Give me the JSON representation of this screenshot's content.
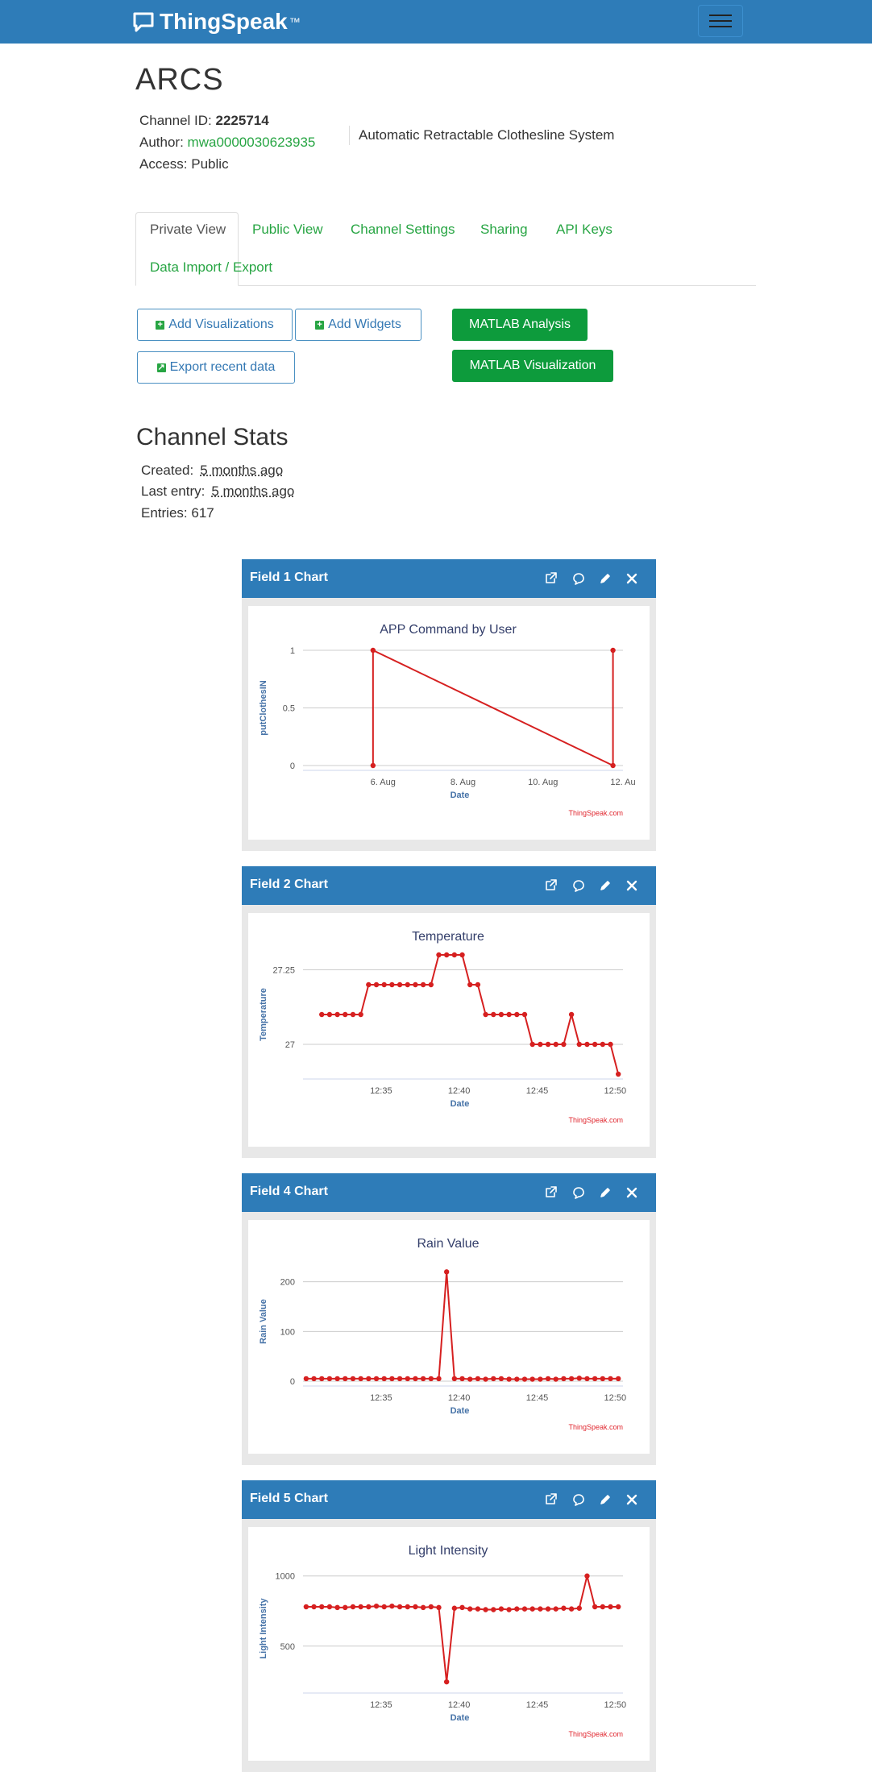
{
  "navbar": {
    "brand": "ThingSpeak",
    "brand_tm": "™"
  },
  "channel": {
    "name": "ARCS",
    "id_label": "Channel ID:",
    "id_value": "2225714",
    "author_label": "Author:",
    "author_value": "mwa0000030623935",
    "access_label": "Access:",
    "access_value": "Public",
    "description": "Automatic Retractable Clothesline System"
  },
  "tabs": [
    "Private View",
    "Public View",
    "Channel Settings",
    "Sharing",
    "API Keys",
    "Data Import / Export"
  ],
  "buttons": {
    "add_visualizations": "Add Visualizations",
    "add_widgets": "Add Widgets",
    "export_recent": "Export recent data",
    "matlab_analysis": "MATLAB Analysis",
    "matlab_visualization": "MATLAB Visualization"
  },
  "stats": {
    "heading": "Channel Stats",
    "created_label": "Created:",
    "created_value": "5 months ago",
    "last_entry_label": "Last entry:",
    "last_entry_value": "5 months ago",
    "entries_label": "Entries:",
    "entries_value": "617"
  },
  "colors": {
    "navbar": "#2e7cb8",
    "link": "#27a543",
    "matlab_button": "#0d9b3c",
    "series": "#d62020"
  },
  "icons": [
    "external-link-icon",
    "comment-icon",
    "pencil-icon",
    "close-icon"
  ],
  "credit": "ThingSpeak.com",
  "chart_data": [
    {
      "panel_title": "Field 1 Chart",
      "type": "line",
      "title": "APP Command by User",
      "xlabel": "Date",
      "ylabel": "putClothesIN",
      "x_ticks": [
        "6. Aug",
        "8. Aug",
        "10. Aug",
        "12. Au"
      ],
      "y_ticks": [
        "0",
        "0.5",
        "1"
      ],
      "ylim": [
        0,
        1
      ],
      "x_unit": "days since 4 Aug",
      "xlim": [
        0,
        8
      ],
      "x_tick_values": [
        2,
        4,
        6,
        8
      ],
      "y_tick_values": [
        0,
        0.5,
        1
      ],
      "series": [
        {
          "x": [
            1.75,
            1.75,
            7.75,
            7.75
          ],
          "values": [
            0,
            1,
            0,
            1
          ]
        }
      ]
    },
    {
      "panel_title": "Field 2 Chart",
      "type": "line",
      "title": "Temperature",
      "xlabel": "Date",
      "ylabel": "Temperature",
      "x_ticks": [
        "12:35",
        "12:40",
        "12:45",
        "12:50"
      ],
      "y_ticks": [
        "27",
        "27.25"
      ],
      "ylim": [
        26.9,
        27.3
      ],
      "xlim": [
        30,
        50.5
      ],
      "x_tick_values": [
        35,
        40,
        45,
        50
      ],
      "y_tick_values": [
        27,
        27.25
      ],
      "series": [
        {
          "x": [
            31.2,
            31.7,
            32.2,
            32.7,
            33.2,
            33.7,
            34.2,
            34.7,
            35.2,
            35.7,
            36.2,
            36.7,
            37.2,
            37.7,
            38.2,
            38.7,
            39.2,
            39.7,
            40.2,
            40.7,
            41.2,
            41.7,
            42.2,
            42.7,
            43.2,
            43.7,
            44.2,
            44.7,
            45.2,
            45.7,
            46.2,
            46.7,
            47.2,
            47.7,
            48.2,
            48.7,
            49.2,
            49.7,
            50.2
          ],
          "values": [
            27.1,
            27.1,
            27.1,
            27.1,
            27.1,
            27.1,
            27.2,
            27.2,
            27.2,
            27.2,
            27.2,
            27.2,
            27.2,
            27.2,
            27.2,
            27.3,
            27.3,
            27.3,
            27.3,
            27.2,
            27.2,
            27.1,
            27.1,
            27.1,
            27.1,
            27.1,
            27.1,
            27.0,
            27.0,
            27.0,
            27.0,
            27.0,
            27.1,
            27.0,
            27.0,
            27.0,
            27.0,
            27.0,
            26.9
          ]
        }
      ]
    },
    {
      "panel_title": "Field 4 Chart",
      "type": "line",
      "title": "Rain Value",
      "xlabel": "Date",
      "ylabel": "Rain Value",
      "x_ticks": [
        "12:35",
        "12:40",
        "12:45",
        "12:50"
      ],
      "y_ticks": [
        "0",
        "100",
        "200"
      ],
      "ylim": [
        0,
        240
      ],
      "xlim": [
        30,
        50.5
      ],
      "x_tick_values": [
        35,
        40,
        45,
        50
      ],
      "y_tick_values": [
        0,
        100,
        200
      ],
      "series": [
        {
          "x": [
            30.2,
            30.7,
            31.2,
            31.7,
            32.2,
            32.7,
            33.2,
            33.7,
            34.2,
            34.7,
            35.2,
            35.7,
            36.2,
            36.7,
            37.2,
            37.7,
            38.2,
            38.7,
            39.2,
            39.7,
            40.2,
            40.7,
            41.2,
            41.7,
            42.2,
            42.7,
            43.2,
            43.7,
            44.2,
            44.7,
            45.2,
            45.7,
            46.2,
            46.7,
            47.2,
            47.7,
            48.2,
            48.7,
            49.2,
            49.7,
            50.2
          ],
          "values": [
            5,
            5,
            5,
            5,
            5,
            5,
            5,
            5,
            5,
            5,
            5,
            5,
            5,
            5,
            5,
            5,
            5,
            5,
            220,
            5,
            5,
            4,
            5,
            4,
            5,
            5,
            4,
            4,
            4,
            4,
            4,
            5,
            4,
            5,
            5,
            6,
            5,
            5,
            5,
            5,
            5
          ]
        }
      ]
    },
    {
      "panel_title": "Field 5 Chart",
      "type": "line",
      "title": "Light Intensity",
      "xlabel": "Date",
      "ylabel": "Light Intensity",
      "x_ticks": [
        "12:35",
        "12:40",
        "12:45",
        "12:50"
      ],
      "y_ticks": [
        "500",
        "1000"
      ],
      "ylim": [
        200,
        1050
      ],
      "xlim": [
        30,
        50.5
      ],
      "x_tick_values": [
        35,
        40,
        45,
        50
      ],
      "y_tick_values": [
        500,
        1000
      ],
      "series": [
        {
          "x": [
            30.2,
            30.7,
            31.2,
            31.7,
            32.2,
            32.7,
            33.2,
            33.7,
            34.2,
            34.7,
            35.2,
            35.7,
            36.2,
            36.7,
            37.2,
            37.7,
            38.2,
            38.7,
            39.2,
            39.7,
            40.2,
            40.7,
            41.2,
            41.7,
            42.2,
            42.7,
            43.2,
            43.7,
            44.2,
            44.7,
            45.2,
            45.7,
            46.2,
            46.7,
            47.2,
            47.7,
            48.2,
            48.7,
            49.2,
            49.7,
            50.2
          ],
          "values": [
            780,
            780,
            780,
            780,
            775,
            775,
            780,
            780,
            780,
            785,
            780,
            785,
            780,
            780,
            780,
            775,
            780,
            775,
            245,
            770,
            775,
            765,
            765,
            760,
            760,
            765,
            760,
            765,
            765,
            765,
            765,
            765,
            765,
            770,
            765,
            770,
            1000,
            780,
            780,
            780,
            780
          ]
        }
      ]
    }
  ]
}
